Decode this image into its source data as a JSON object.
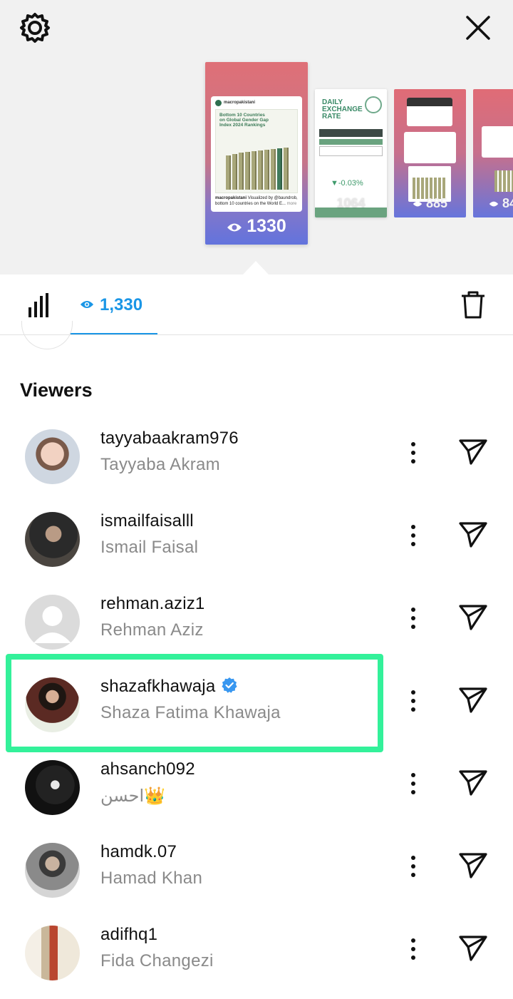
{
  "toolbar": {
    "settings_icon": "gear-icon",
    "close_icon": "close-icon"
  },
  "stories": [
    {
      "views": "1330",
      "brand": "macropakistani",
      "title": "Bottom 10 Countries on Global Gender Gap Index 2024 Rankings",
      "caption_user": "macropakistani",
      "caption_text": " Visualized by @baundrob, bottom 10 countries on the World E...",
      "caption_more": "more"
    },
    {
      "views": "1064",
      "title": "DAILY EXCHANGE RATE",
      "change": "▼-0.03%"
    },
    {
      "views": "885"
    },
    {
      "views": "84"
    }
  ],
  "tabs": {
    "views_count": "1,330"
  },
  "viewers_title": "Viewers",
  "viewers": [
    {
      "username": "tayyabaakram976",
      "name": "Tayyaba Akram",
      "verified": false
    },
    {
      "username": "ismailfaisalll",
      "name": "Ismail Faisal",
      "verified": false
    },
    {
      "username": "rehman.aziz1",
      "name": "Rehman Aziz",
      "verified": false
    },
    {
      "username": "shazafkhawaja",
      "name": "Shaza Fatima Khawaja",
      "verified": true
    },
    {
      "username": "ahsanch092",
      "name": "احسن👑",
      "verified": false
    },
    {
      "username": "hamdk.07",
      "name": "Hamad Khan",
      "verified": false
    },
    {
      "username": "adifhq1",
      "name": "Fida Changezi",
      "verified": false
    }
  ],
  "colors": {
    "accent": "#1a96e6",
    "highlight": "#33f19a",
    "verified": "#3897f0"
  }
}
